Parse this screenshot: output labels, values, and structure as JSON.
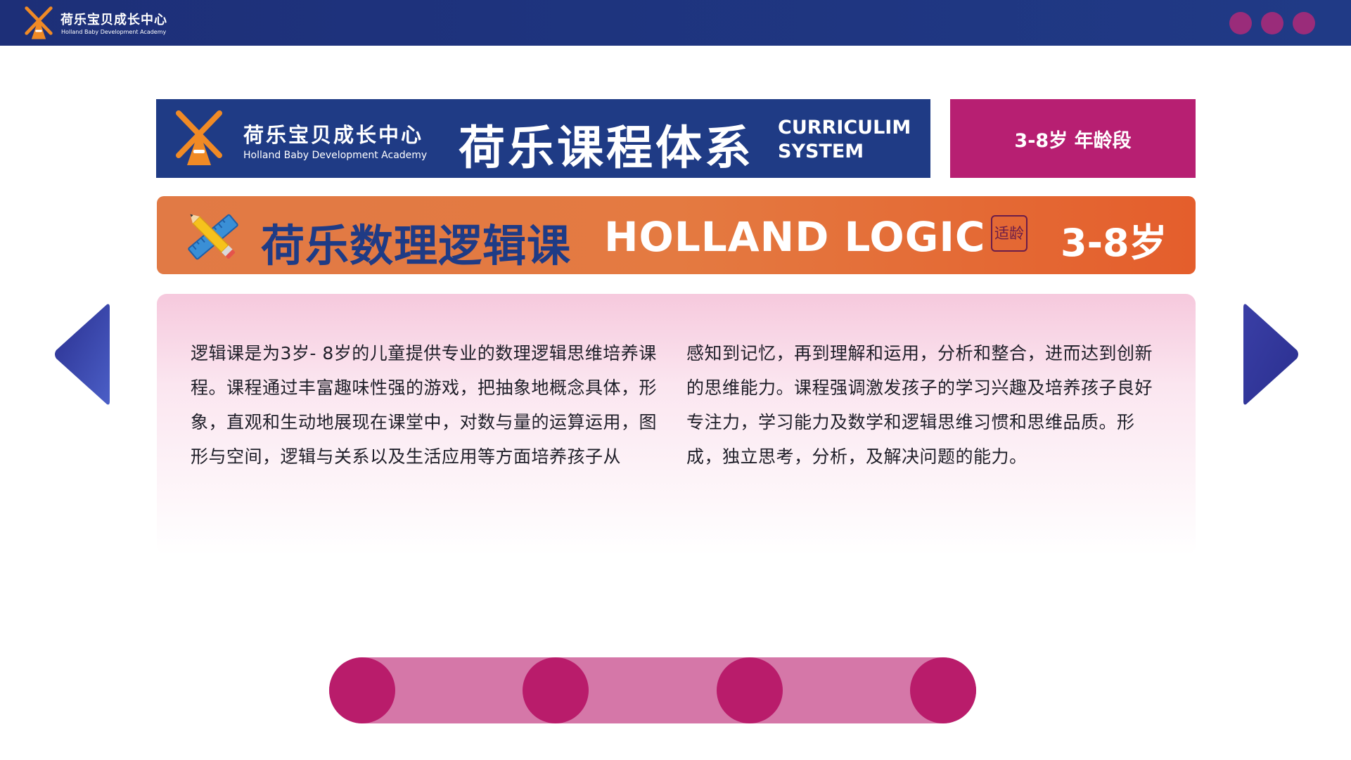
{
  "header": {
    "brand_cn": "荷乐宝贝成长中心",
    "brand_en": "Holland Baby Development Academy",
    "window_dots": [
      "dot",
      "dot",
      "dot"
    ]
  },
  "banner": {
    "brand_cn": "荷乐宝贝成长中心",
    "brand_en": "Holland Baby Development Academy",
    "title_cn": "荷乐课程体系",
    "title_en_line1": "CURRICULIM",
    "title_en_line2": "SYSTEM",
    "age_range": "3-8岁  年龄段"
  },
  "course": {
    "title_cn": "荷乐数理逻辑课",
    "title_en": "HOLLAND LOGIC",
    "age_seal": "适龄",
    "age": "3-8岁",
    "icon": "ruler-pencil-icon"
  },
  "description": {
    "left_column": "逻辑课是为3岁- 8岁的儿童提供专业的数理逻辑思维培养课程。课程通过丰富趣味性强的游戏，把抽象地概念具体，形象，直观和生动地展现在课堂中，对数与量的运算运用，图形与空间，逻辑与关系以及生活应用等方面培养孩子从",
    "right_column": "感知到记忆，再到理解和运用，分析和整合，进而达到创新的思维能力。课程强调激发孩子的学习兴趣及培养孩子良好专注力，学习能力及数学和逻辑思维习惯和思维品质。形成，独立思考，分析，及解决问题的能力。"
  },
  "navigation": {
    "prev_icon": "arrow-left-icon",
    "next_icon": "arrow-right-icon"
  },
  "stepper": {
    "steps": 4
  },
  "colors": {
    "navy": "#1f3b85",
    "magenta": "#b71f72",
    "orange": "#e4773f",
    "pink_track": "#d577a8",
    "dot_purple": "#9a2c7a"
  }
}
